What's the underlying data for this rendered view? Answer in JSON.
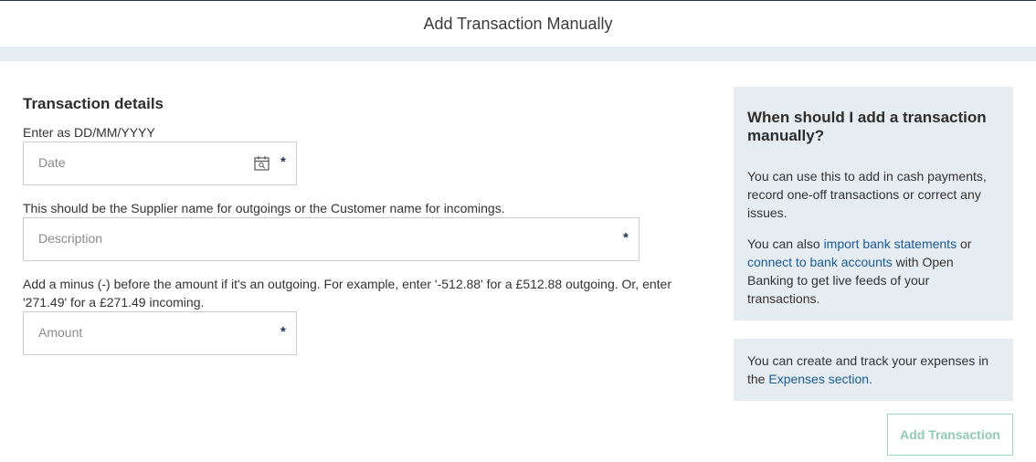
{
  "header": {
    "title": "Add Transaction Manually"
  },
  "form": {
    "section_title": "Transaction details",
    "date_hint": "Enter as DD/MM/YYYY",
    "date_placeholder": "Date",
    "date_required": "*",
    "description_hint": "This should be the Supplier name for outgoings or the Customer name for incomings.",
    "description_placeholder": "Description",
    "description_required": "*",
    "amount_hint_line1": "Add a minus (-) before the amount if it's an outgoing. For example, enter '-512.88' for a £512.88 outgoing. Or, enter",
    "amount_hint_line2": "'271.49' for a £271.49 incoming.",
    "amount_placeholder": "Amount",
    "amount_required": "*"
  },
  "info_panel": {
    "title": "When should I add a transaction manually?",
    "para1": "You can use this to add in cash payments, record one-off transactions or correct any issues.",
    "para2_prefix": "You can also ",
    "link_import": "import bank statements",
    "para2_mid": " or ",
    "link_connect": "connect to bank accounts",
    "para2_suffix": " with Open Banking to get live feeds of your transactions."
  },
  "expenses_panel": {
    "text_prefix": "You can create and track your expenses in the ",
    "link_expenses": "Expenses section."
  },
  "actions": {
    "add_transaction": "Add Transaction"
  },
  "icons": {
    "calendar": "calendar-icon"
  },
  "colors": {
    "accent_link": "#1a5a96",
    "panel_bg": "#e5ecf2",
    "button_text": "#8fcbb4",
    "button_border": "#9fd8c2"
  }
}
